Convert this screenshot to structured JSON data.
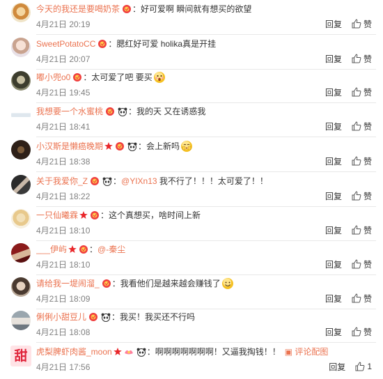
{
  "colors": {
    "username": "#eb7350",
    "text": "#333333",
    "time": "#808080",
    "divider": "#e8e8e8"
  },
  "actions": {
    "reply_label": "回复",
    "like_label": "赞"
  },
  "comments": [
    {
      "username": "今天的我还是要喝奶茶",
      "colon": "：",
      "text": "好可爱啊 瞬间就有想买的欲望",
      "time": "4月21日 20:19"
    },
    {
      "username": "SweetPotatoCC",
      "colon": "：",
      "text": "腮红好可爱 holika真是开挂",
      "time": "4月21日 20:07"
    },
    {
      "username": "嘟小兜o0",
      "colon": "：",
      "text": "太可爱了吧 要买",
      "time": "4月21日 19:45"
    },
    {
      "username": "我想要一个水蜜桃",
      "colon": "：",
      "text": "我的天 又在诱惑我",
      "time": "4月21日 18:41"
    },
    {
      "username": "小汉斯是懒癌晚期",
      "colon": "：",
      "text": "会上新吗",
      "time": "4月21日 18:38"
    },
    {
      "username": "关于我爱你_Z",
      "colon": "：",
      "mention": "@YIXn13",
      "text": "我不行了！！！太可爱了！！",
      "time": "4月21日 18:22"
    },
    {
      "username": "一只仙曦霖",
      "colon": "：",
      "text": "这个真想买，啥时间上新",
      "time": "4月21日 18:10"
    },
    {
      "username": "___伊屿",
      "colon": "：",
      "mention": "@-秦尘",
      "text": "",
      "time": "4月21日 18:10"
    },
    {
      "username": "请给我一堤闹溜_",
      "colon": "：",
      "text": "我看他们是越来越会赚钱了",
      "time": "4月21日 18:09"
    },
    {
      "username": "俐俐小甜豆儿",
      "colon": "：",
      "text": "我买！我买还不行吗",
      "time": "4月21日 18:08"
    },
    {
      "username": "虎梨脾虾肉酱_moon",
      "colon": "：",
      "text": "啊啊啊啊啊啊啊！又逼我掏钱！！",
      "pic_link": "评论配图",
      "avatar_char": "甜",
      "time": "4月21日 17:56",
      "likes": "1"
    }
  ]
}
